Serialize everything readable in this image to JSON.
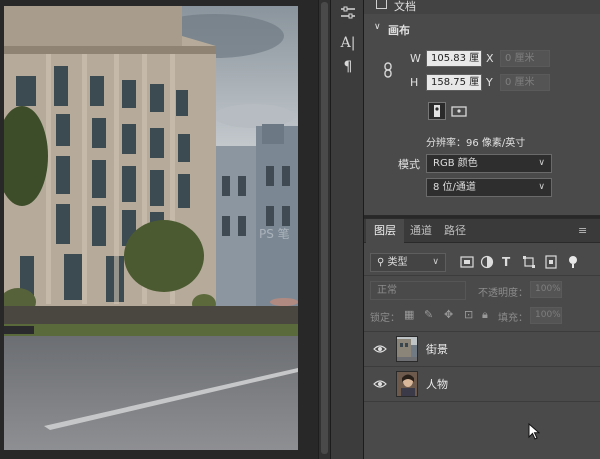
{
  "properties": {
    "doc_label": "文档",
    "canvas_section": "画布",
    "width_label": "W",
    "width_value": "105.83 厘",
    "height_label": "H",
    "height_value": "158.75 厘",
    "x_label": "X",
    "x_value": "0 厘米",
    "y_label": "Y",
    "y_value": "0 厘米",
    "resolution": "分辨率：96 像素/英寸",
    "mode_label": "模式",
    "mode_value": "RGB 颜色",
    "depth_value": "8 位/通道"
  },
  "layers_panel": {
    "tabs": [
      "图层",
      "通道",
      "路径"
    ],
    "filter_kind": "类型",
    "blend_mode": "正常",
    "opacity_label": "不透明度：",
    "opacity_value": "100%",
    "lock_label": "锁定：",
    "fill_label": "填充：",
    "fill_value": "100%",
    "layers": [
      {
        "name": "街景",
        "visible": true
      },
      {
        "name": "人物",
        "visible": true
      }
    ]
  },
  "watermark": "PS 笔",
  "colors": {
    "panel_bg": "#4a4a4a",
    "app_bg": "#282828",
    "field_bg": "#e8e8e8",
    "dropdown_bg": "#2e2e2e"
  }
}
